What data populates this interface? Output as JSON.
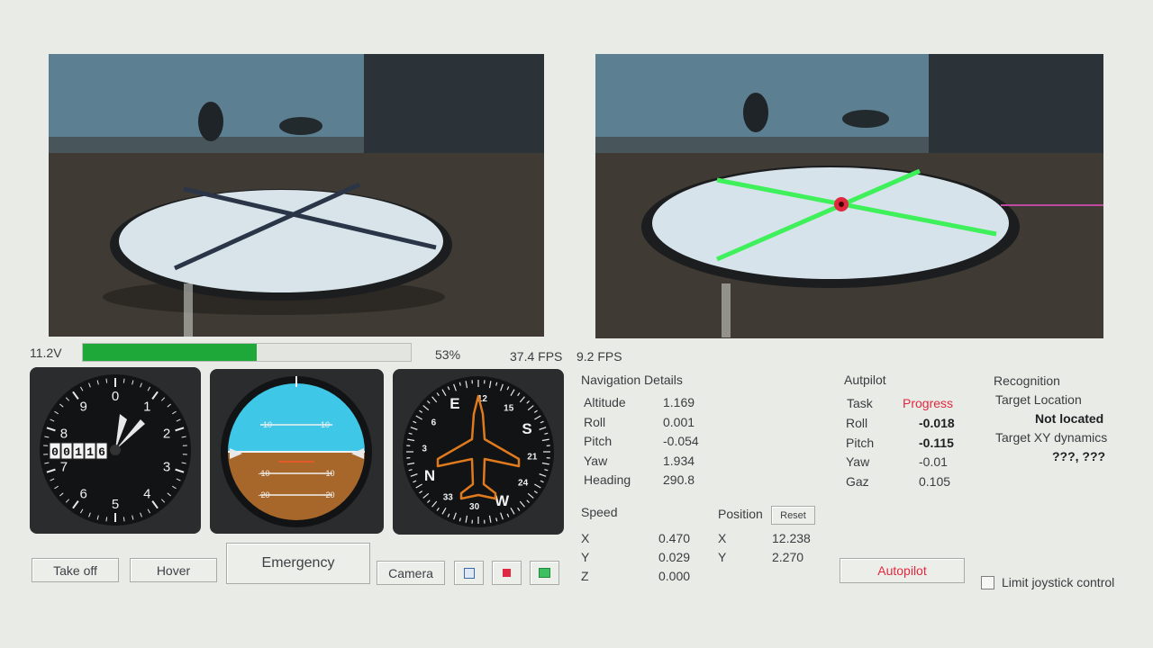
{
  "status": {
    "battery": "11.2V",
    "progress_percent": 53,
    "progress_label": "53%",
    "fps_left": "37.4 FPS",
    "fps_right": "9.2 FPS"
  },
  "altimeter": {
    "counter_digits": [
      "0",
      "0",
      "1",
      "1",
      "6"
    ],
    "numbers": [
      "0",
      "1",
      "2",
      "3",
      "4",
      "5",
      "6",
      "7",
      "8",
      "9"
    ]
  },
  "attitude": {
    "pitch_labels": [
      "10",
      "10",
      "-10",
      "-10",
      "-20",
      "-20"
    ]
  },
  "heading_indicator": {
    "labels": [
      "E",
      "12",
      "15",
      "S",
      "21",
      "24",
      "W",
      "30",
      "33",
      "N",
      "3",
      "6"
    ]
  },
  "navigation": {
    "title": "Navigation Details",
    "rows": [
      {
        "label": "Altitude",
        "value": "1.169"
      },
      {
        "label": "Roll",
        "value": "0.001"
      },
      {
        "label": "Pitch",
        "value": "-0.054"
      },
      {
        "label": "Yaw",
        "value": "1.934"
      },
      {
        "label": "Heading",
        "value": "290.8"
      }
    ],
    "speed_title": "Speed",
    "speed": [
      {
        "label": "X",
        "value": "0.470"
      },
      {
        "label": "Y",
        "value": "0.029"
      },
      {
        "label": "Z",
        "value": "0.000"
      }
    ],
    "position_title": "Position",
    "reset_label": "Reset",
    "position": [
      {
        "label": "X",
        "value": "12.238"
      },
      {
        "label": "Y",
        "value": "2.270"
      }
    ]
  },
  "autopilot": {
    "title": "Autpilot",
    "task_label": "Task",
    "task_value": "Progress",
    "rows": [
      {
        "label": "Roll",
        "value": "-0.018"
      },
      {
        "label": "Pitch",
        "value": "-0.115"
      },
      {
        "label": "Yaw",
        "value": "-0.01"
      },
      {
        "label": "Gaz",
        "value": "0.105"
      }
    ],
    "button_label": "Autopilot"
  },
  "recognition": {
    "title": "Recognition",
    "target_location_label": "Target Location",
    "target_location_value": "Not located",
    "xy_dynamics_label": "Target XY dynamics",
    "xy_dynamics_value": "???, ???"
  },
  "controls": {
    "takeoff": "Take off",
    "hover": "Hover",
    "emergency": "Emergency",
    "camera": "Camera",
    "limit_joystick": "Limit joystick control"
  },
  "colors": {
    "progress_green": "#1fa83a",
    "task_red": "#e02840",
    "overlay_green": "#3ef05a",
    "sky": "#3ec7e6",
    "ground": "#a7672a",
    "compass_plane": "#e07a1e"
  }
}
